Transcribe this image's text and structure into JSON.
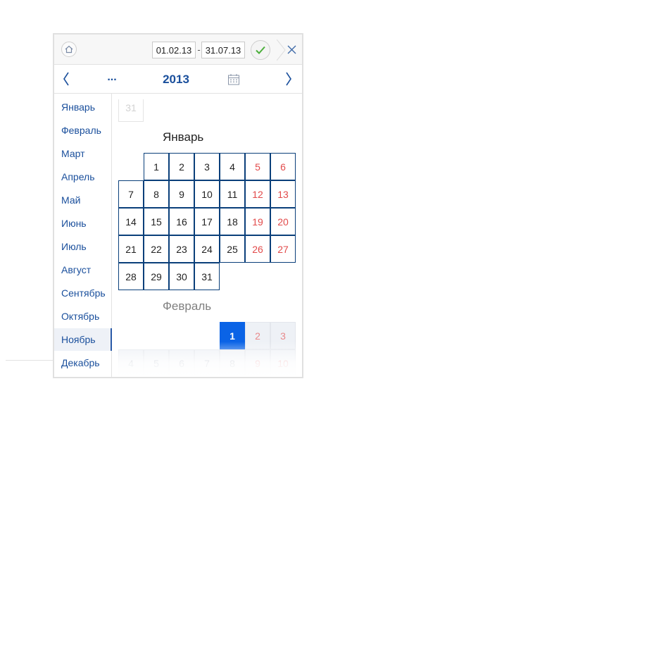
{
  "toolbar": {
    "date_from": "01.02.13",
    "date_separator": "-",
    "date_to": "31.07.13"
  },
  "navbar": {
    "ellipsis": "...",
    "year": "2013"
  },
  "sidebar": {
    "months": [
      "Январь",
      "Февраль",
      "Март",
      "Апрель",
      "Май",
      "Июнь",
      "Июль",
      "Август",
      "Сентябрь",
      "Октябрь",
      "Ноябрь",
      "Декабрь"
    ],
    "selected": "Ноябрь"
  },
  "calendar": {
    "prev_trailing_day": "31",
    "january": {
      "title": "Январь",
      "weeks": [
        [
          "",
          "1",
          "2",
          "3",
          "4",
          "5",
          "6"
        ],
        [
          "7",
          "8",
          "9",
          "10",
          "11",
          "12",
          "13"
        ],
        [
          "14",
          "15",
          "16",
          "17",
          "18",
          "19",
          "20"
        ],
        [
          "21",
          "22",
          "23",
          "24",
          "25",
          "26",
          "27"
        ],
        [
          "28",
          "29",
          "30",
          "31",
          "",
          "",
          ""
        ]
      ]
    },
    "february": {
      "title": "Февраль",
      "selected_day": "1",
      "weeks": [
        [
          "",
          "",
          "",
          "",
          "1",
          "2",
          "3"
        ],
        [
          "4",
          "5",
          "6",
          "7",
          "8",
          "9",
          "10"
        ]
      ]
    }
  },
  "colors": {
    "accent": "#1a4f9c",
    "weekend": "#e24b4b",
    "selected_day": "#0a63e6",
    "confirm": "#4caf3c"
  },
  "icons": [
    "home-icon",
    "check-icon",
    "close-icon",
    "chevron-left-icon",
    "chevron-right-icon",
    "calendar-icon"
  ]
}
